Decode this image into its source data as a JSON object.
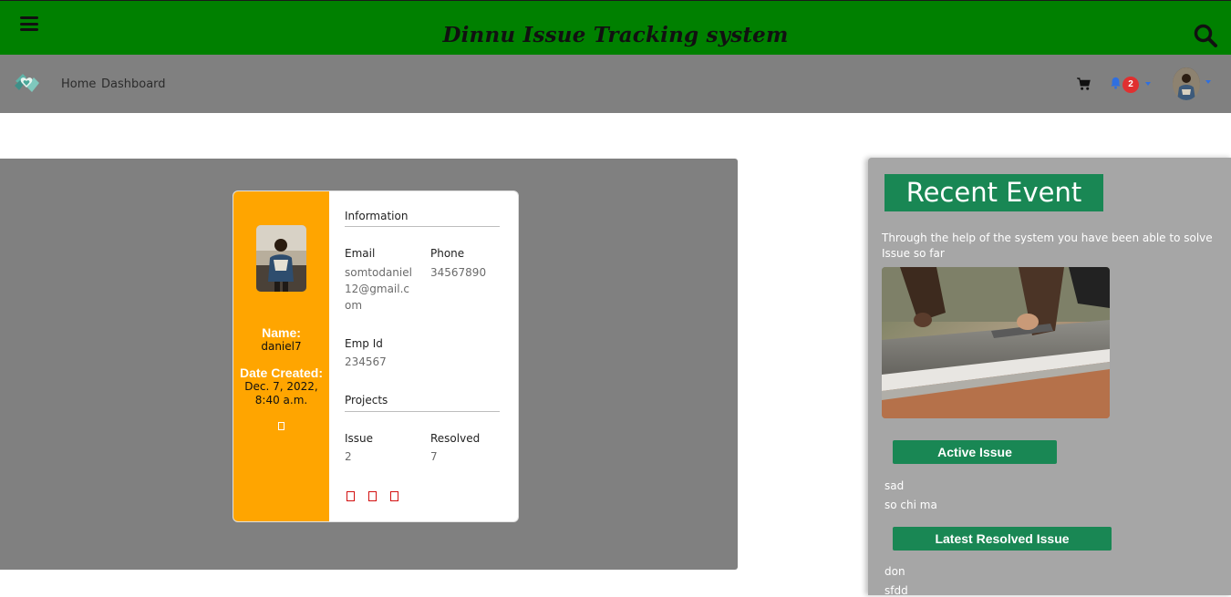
{
  "header": {
    "title": "Dinnu Issue Tracking system",
    "menu_icon": "hamburger-menu-icon",
    "search_icon": "search-icon",
    "bg_color": "#008000"
  },
  "nav": {
    "links": [
      "Home",
      "Dashboard"
    ],
    "notification_count": "2",
    "bg_color": "#808080"
  },
  "profile": {
    "name_label": "Name:",
    "name": "daniel7",
    "date_label": "Date Created:",
    "date_line1": "Dec. 7, 2022,",
    "date_line2": "8:40 a.m.",
    "information_title": "Information",
    "email_label": "Email",
    "email": "somtodaniel12@gmail.com",
    "phone_label": "Phone",
    "phone": "34567890",
    "emp_id_label": "Emp Id",
    "emp_id": "234567",
    "projects_title": "Projects",
    "issue_label": "Issue",
    "issue": "2",
    "resolved_label": "Resolved",
    "resolved": "7",
    "accent_color": "#ffa500"
  },
  "sidebar": {
    "heading": "Recent Event",
    "text": "Through the help of the system you have been able to solve Issue so far",
    "active_issue_title": "Active Issue",
    "active_issues": [
      "sad",
      "so chi ma"
    ],
    "resolved_title": "Latest Resolved Issue",
    "resolved_issues": [
      "don",
      "sfdd"
    ],
    "accent_color": "#198754"
  }
}
